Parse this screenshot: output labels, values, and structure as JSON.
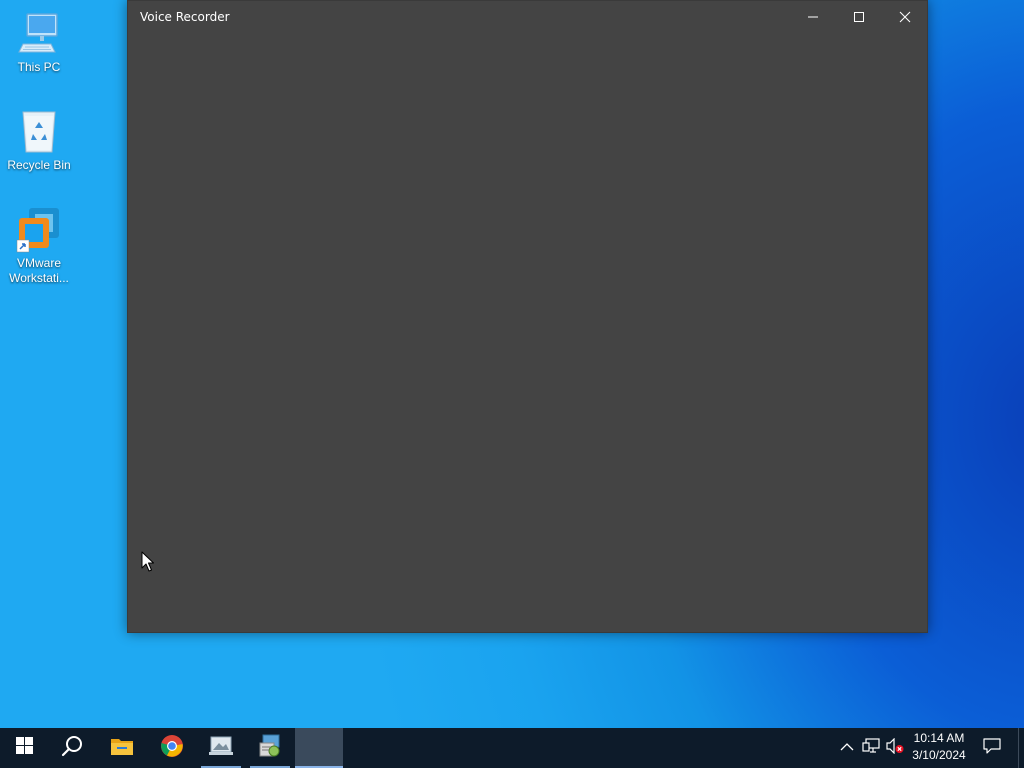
{
  "desktop": {
    "icons": [
      {
        "label": "This PC",
        "icon": "computer-icon"
      },
      {
        "label": "Recycle Bin",
        "icon": "recycle-bin-icon"
      },
      {
        "label_line1": "VMware",
        "label_line2": "Workstati...",
        "icon": "vmware-icon"
      }
    ]
  },
  "window": {
    "title": "Voice Recorder",
    "background": "#444444",
    "controls": {
      "minimize": "minimize-icon",
      "maximize": "maximize-icon",
      "close": "close-icon"
    }
  },
  "taskbar": {
    "items": [
      {
        "icon": "windows-start-icon"
      },
      {
        "icon": "search-icon"
      },
      {
        "icon": "file-explorer-icon"
      },
      {
        "icon": "chrome-icon"
      },
      {
        "icon": "photo-app-icon"
      },
      {
        "icon": "installer-icon"
      },
      {
        "icon": "voice-recorder-taskbar-icon"
      }
    ],
    "tray": {
      "icons": [
        "chevron-up-icon",
        "network-icon",
        "volume-muted-icon"
      ]
    },
    "clock": {
      "time": "10:14 AM",
      "date": "3/10/2024"
    },
    "background": "#0d1b2a"
  }
}
